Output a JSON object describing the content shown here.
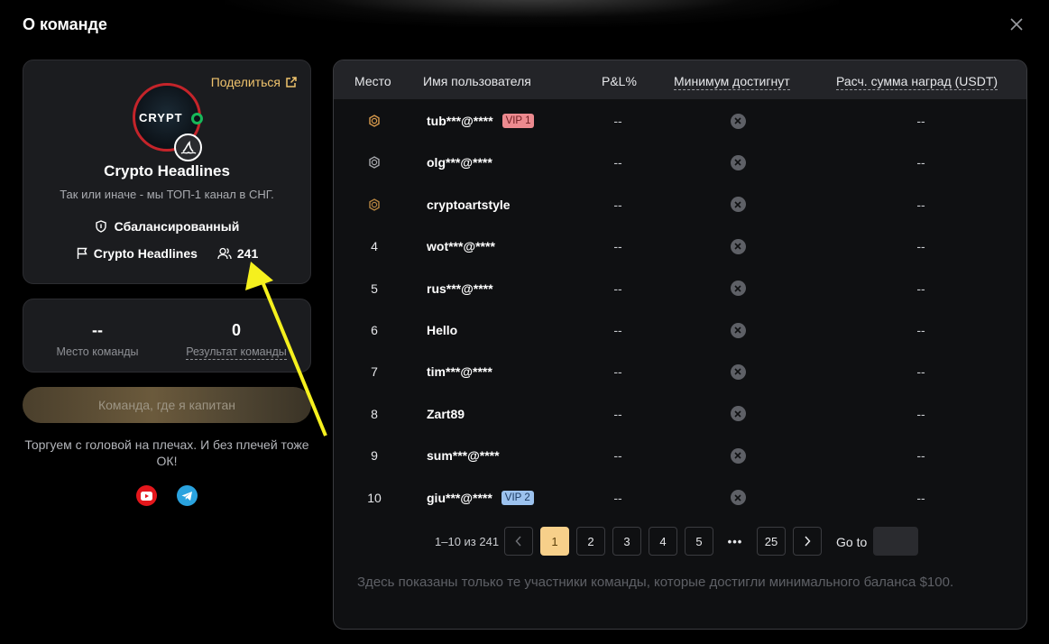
{
  "modal": {
    "title": "О команде"
  },
  "profile": {
    "share_label": "Поделиться",
    "avatar_text": "CRYPT",
    "team_name": "Crypto Headlines",
    "description": "Так или иначе - мы ТОП-1 канал в СНГ.",
    "style_label": "Сбалансированный",
    "captain_name": "Crypto Headlines",
    "member_count": "241"
  },
  "stats": {
    "rank_value": "--",
    "rank_label": "Место команды",
    "result_value": "0",
    "result_label": "Результат команды"
  },
  "captain_button_label": "Команда, где я капитан",
  "motto": "Торгуем с головой на плечах. И без плечей тоже ОК!",
  "socials": [
    "youtube-icon",
    "telegram-icon"
  ],
  "table": {
    "headers": {
      "rank": "Место",
      "user": "Имя пользователя",
      "pnl": "P&L%",
      "min": "Минимум достигнут",
      "reward": "Расч. сумма наград (USDT)"
    },
    "rows": [
      {
        "rank": "",
        "medal": "gold",
        "user": "tub***@****",
        "vip": "VIP 1",
        "pnl": "--",
        "reward": "--"
      },
      {
        "rank": "",
        "medal": "silver",
        "user": "olg***@****",
        "vip": "",
        "pnl": "--",
        "reward": "--"
      },
      {
        "rank": "",
        "medal": "bronze",
        "user": "cryptoartstyle",
        "vip": "",
        "pnl": "--",
        "reward": "--"
      },
      {
        "rank": "4",
        "medal": "",
        "user": "wot***@****",
        "vip": "",
        "pnl": "--",
        "reward": "--"
      },
      {
        "rank": "5",
        "medal": "",
        "user": "rus***@****",
        "vip": "",
        "pnl": "--",
        "reward": "--"
      },
      {
        "rank": "6",
        "medal": "",
        "user": "Hello",
        "vip": "",
        "pnl": "--",
        "reward": "--"
      },
      {
        "rank": "7",
        "medal": "",
        "user": "tim***@****",
        "vip": "",
        "pnl": "--",
        "reward": "--"
      },
      {
        "rank": "8",
        "medal": "",
        "user": "Zart89",
        "vip": "",
        "pnl": "--",
        "reward": "--"
      },
      {
        "rank": "9",
        "medal": "",
        "user": "sum***@****",
        "vip": "",
        "pnl": "--",
        "reward": "--"
      },
      {
        "rank": "10",
        "medal": "",
        "user": "giu***@****",
        "vip": "VIP 2",
        "pnl": "--",
        "reward": "--"
      }
    ]
  },
  "pagination": {
    "info": "1–10 из 241",
    "pages": [
      "1",
      "2",
      "3",
      "4",
      "5"
    ],
    "ellipsis": "•••",
    "last_page": "25",
    "current": "1",
    "goto_label": "Go to",
    "goto_value": ""
  },
  "footnote": "Здесь показаны только те участники команды, которые достигли минимального баланса $100.",
  "colors": {
    "accent_gold": "#f0c36d",
    "vip1_bg": "#ec8a8f",
    "vip2_bg": "#9cc2ee",
    "annotation_arrow": "#f5f01e"
  }
}
